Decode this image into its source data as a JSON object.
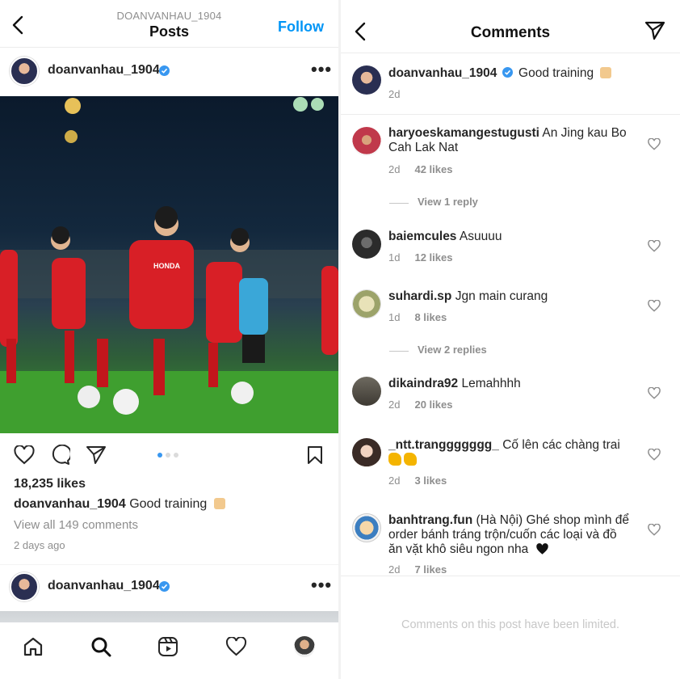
{
  "left": {
    "header": {
      "subtitle": "DOANVANHAU_1904",
      "title": "Posts",
      "follow_label": "Follow"
    },
    "post": {
      "username": "doanvanhau_1904",
      "more_label": "•••",
      "likes": "18,235 likes",
      "caption_user": "doanvanhau_1904",
      "caption_text": "Good training",
      "view_all": "View all 149 comments",
      "time_ago": "2 days ago",
      "carousel_dots": 3,
      "carousel_active": 0,
      "photo_sponsor_text": "HONDA"
    },
    "next_post": {
      "username": "doanvanhau_1904",
      "more_label": "•••"
    },
    "tabbar": [
      "home-icon",
      "search-icon",
      "reels-icon",
      "activity-heart-icon",
      "profile-avatar"
    ]
  },
  "right": {
    "header": {
      "title": "Comments"
    },
    "caption_comment": {
      "username": "doanvanhau_1904",
      "text": "Good training",
      "time": "2d"
    },
    "comments": [
      {
        "username": "haryoeskamangestugusti",
        "text": "An Jing kau Bo Cah Lak Nat",
        "time": "2d",
        "likes": "42 likes",
        "replies": "View 1 reply"
      },
      {
        "username": "baiemcules",
        "text": "Asuuuu",
        "time": "1d",
        "likes": "12 likes"
      },
      {
        "username": "suhardi.sp",
        "text": "Jgn main curang",
        "time": "1d",
        "likes": "8 likes",
        "replies": "View 2 replies"
      },
      {
        "username": "dikaindra92",
        "text": "Lemahhhh",
        "time": "2d",
        "likes": "20 likes"
      },
      {
        "username": "_ntt.tranggggggg_",
        "text": "Cố lên  các chàng trai",
        "time": "2d",
        "likes": "3 likes"
      },
      {
        "username": "banhtrang.fun",
        "text": "(Hà Nội) Ghé shop mình để order bánh tráng trộn/cuốn các loại và đồ ăn vặt khô siêu ngon nha",
        "time": "2d",
        "likes": "7 likes"
      }
    ],
    "limited_notice": "Comments on this post have been limited."
  },
  "colors": {
    "accent": "#0095f6",
    "verified": "#3897f0",
    "muted": "#8e8e8e",
    "jersey_red": "#d81f26"
  }
}
